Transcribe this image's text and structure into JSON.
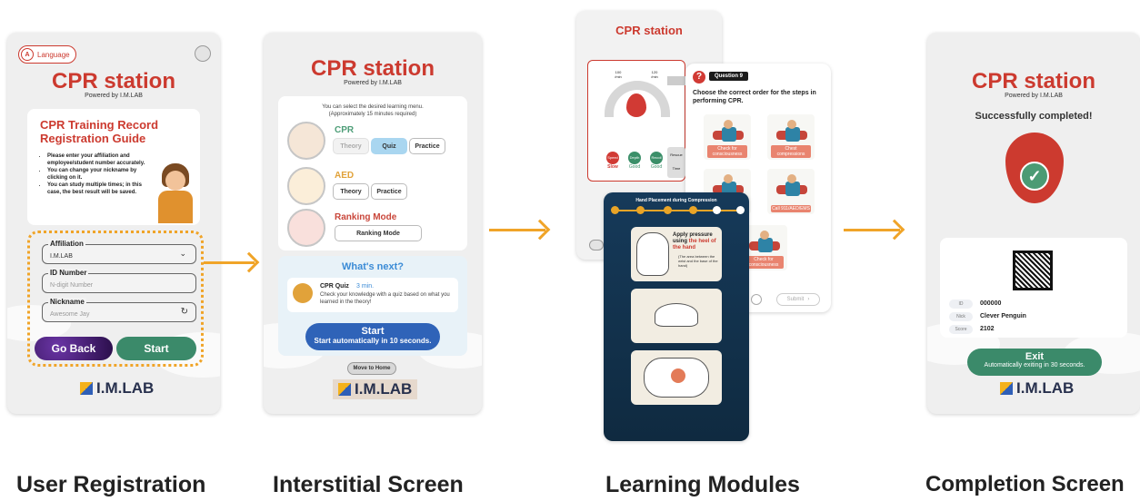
{
  "captions": {
    "registration": "User Registration",
    "interstitial": "Interstitial Screen",
    "learning": "Learning Modules",
    "completion": "Completion Screen"
  },
  "common": {
    "app_title": "CPR station",
    "powered_by": "Powered by I.M.LAB",
    "logo_text": "I.M.LAB"
  },
  "registration": {
    "language_label": "Language",
    "guide_title": "CPR Training Record Registration Guide",
    "guide_bullets": [
      "Please enter your affiliation and employee/student number accurately.",
      "You can change your nickname by clicking on it.",
      "You can study multiple times; in this case, the best result will be saved."
    ],
    "affiliation_label": "Affiliation",
    "affiliation_value": "I.M.LAB",
    "id_label": "ID Number",
    "id_placeholder": "N-digit Number",
    "nickname_label": "Nickname",
    "nickname_placeholder": "Awesome Jay",
    "go_back_label": "Go Back",
    "start_label": "Start"
  },
  "interstitial": {
    "intro": "You can select the desired learning menu.",
    "intro_time": "(Approximately 15 minutes required)",
    "modules": [
      {
        "title": "CPR",
        "color": "#4e9e78",
        "buttons": [
          "Theory",
          "Quiz",
          "Practice"
        ]
      },
      {
        "title": "AED",
        "color": "#e1a23a",
        "buttons": [
          "Theory",
          "Practice"
        ]
      },
      {
        "title": "Ranking Mode",
        "color": "#c9463a",
        "buttons": [
          "Ranking Mode"
        ]
      }
    ],
    "whats_next_title": "What's next?",
    "next_item_title": "CPR Quiz",
    "next_item_time": "3 min.",
    "next_item_desc": "Check your knowledge with a quiz based on what you learned in the theory!",
    "start_label": "Start",
    "start_auto": "Start automatically in 10 seconds.",
    "home_label": "Move to Home"
  },
  "learning": {
    "practice_title": "CPR station",
    "gauge_left": "100 /min",
    "gauge_right": "120 /min",
    "metrics": [
      {
        "name": "Speed",
        "status": "Slow",
        "color": "#d13a34"
      },
      {
        "name": "Depth",
        "status": "Good",
        "color": "#3b8f69"
      },
      {
        "name": "Recoil",
        "status": "Good",
        "color": "#3b8f69"
      }
    ],
    "side_labels": [
      "Rescue",
      "Time"
    ],
    "question_number": "Question 9",
    "question_text": "Choose the correct order for the steps in performing CPR.",
    "quiz_tags": [
      "Check for consciousness",
      "Chest compressions",
      "",
      "Call 911/AED/EMS",
      "Check for consciousness"
    ],
    "submit_label": "Submit",
    "theory_title": "Hand Placement during Compression",
    "theory_steps": [
      "",
      "",
      "",
      "",
      "",
      ""
    ],
    "theory_callout_title_a": "Apply pressure using ",
    "theory_callout_title_b": "the heel of the hand",
    "theory_callout_note": "(The area between the wrist and the base of the hand)"
  },
  "completion": {
    "success_text": "Successfully completed!",
    "id_key": "ID",
    "id_value": "000000",
    "nick_key": "Nick",
    "nick_value": "Clever Penguin",
    "score_key": "Score",
    "score_value": "2102",
    "exit_label": "Exit",
    "exit_auto": "Automatically exiting in 30 seconds."
  },
  "colors": {
    "brand_red": "#cc3a2f",
    "accent_orange": "#f0a428",
    "start_green": "#3b8a6a",
    "go_back_purple": "#3b1464",
    "start_blue": "#2f63b8",
    "theory_navy": "#1d3e5b"
  }
}
